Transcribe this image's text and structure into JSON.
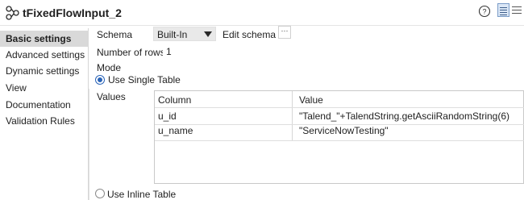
{
  "header": {
    "title": "tFixedFlowInput_2",
    "component_icon": "flow-component-icon",
    "help_icon": "help-icon"
  },
  "sidebar": {
    "items": [
      {
        "label": "Basic settings",
        "active": true
      },
      {
        "label": "Advanced settings",
        "active": false
      },
      {
        "label": "Dynamic settings",
        "active": false
      },
      {
        "label": "View",
        "active": false
      },
      {
        "label": "Documentation",
        "active": false
      },
      {
        "label": "Validation Rules",
        "active": false
      }
    ]
  },
  "form": {
    "schema_label": "Schema",
    "schema_value": "Built-In",
    "edit_schema_label": "Edit schema",
    "edit_schema_button": "···",
    "rows_label": "Number of rows",
    "rows_value": "1",
    "mode_label": "Mode",
    "use_single_table": "Use Single Table",
    "values_label": "Values",
    "use_inline_table": "Use Inline Table"
  },
  "values_table": {
    "columns": [
      "Column",
      "Value"
    ],
    "rows": [
      {
        "column": "u_id",
        "value": "\"Talend_\"+TalendString.getAsciiRandomString(6)"
      },
      {
        "column": "u_name",
        "value": "\"ServiceNowTesting\""
      }
    ]
  },
  "colors": {
    "accent": "#2a64b8",
    "selected_sidebar": "#d9d9d9"
  }
}
